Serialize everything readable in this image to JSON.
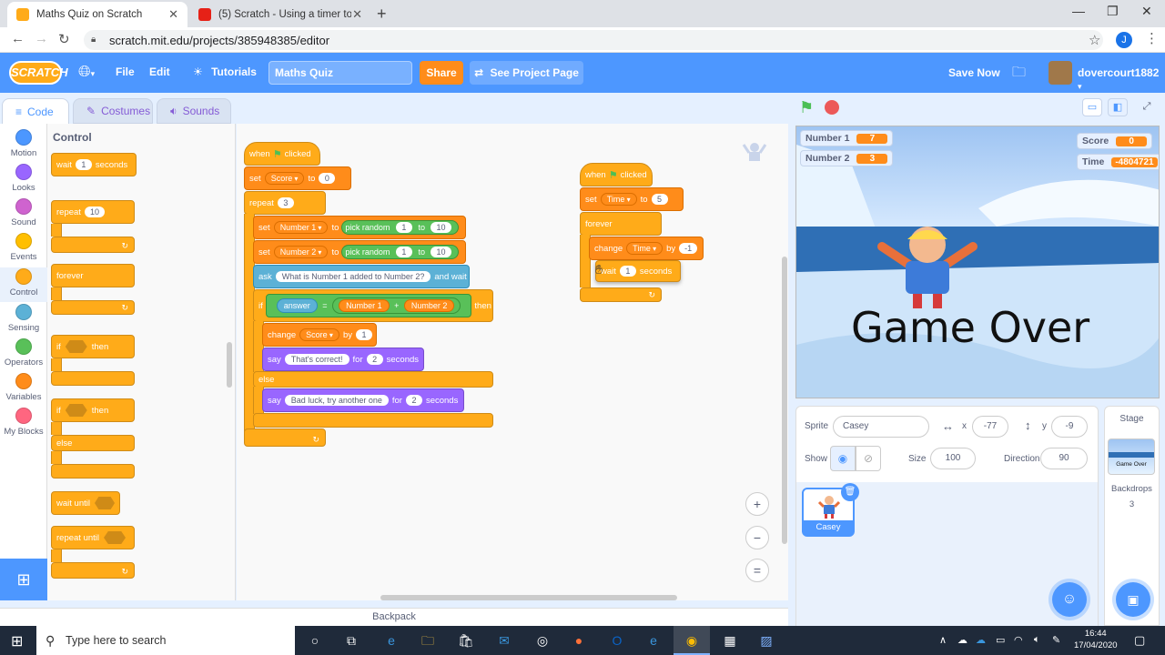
{
  "browser": {
    "tabs": [
      {
        "title": "Maths Quiz on Scratch",
        "close": "✕"
      },
      {
        "title": "(5) Scratch - Using a timer to end",
        "close": "✕"
      }
    ],
    "new_tab": "+",
    "url": "scratch.mit.edu/projects/385948385/editor",
    "profile_initial": "J"
  },
  "menu": {
    "logo": "SCRATCH",
    "file": "File",
    "edit": "Edit",
    "tutorials": "Tutorials",
    "project_title": "Maths Quiz",
    "share": "Share",
    "see_project": "See Project Page",
    "save_now": "Save Now",
    "username": "dovercourt1882"
  },
  "editor_tabs": {
    "code": "Code",
    "costumes": "Costumes",
    "sounds": "Sounds"
  },
  "categories": [
    {
      "label": "Motion",
      "color": "#4c97ff"
    },
    {
      "label": "Looks",
      "color": "#9966ff"
    },
    {
      "label": "Sound",
      "color": "#cf63cf"
    },
    {
      "label": "Events",
      "color": "#ffbf00"
    },
    {
      "label": "Control",
      "color": "#ffab19"
    },
    {
      "label": "Sensing",
      "color": "#5cb1d6"
    },
    {
      "label": "Operators",
      "color": "#59c059"
    },
    {
      "label": "Variables",
      "color": "#ff8c1a"
    },
    {
      "label": "My Blocks",
      "color": "#ff6680"
    }
  ],
  "palette": {
    "title": "Control",
    "wait": {
      "label": "wait",
      "value": "1",
      "unit": "seconds"
    },
    "repeat": {
      "label": "repeat",
      "value": "10"
    },
    "forever": "forever",
    "if_then": {
      "if": "if",
      "then": "then"
    },
    "if_else": {
      "if": "if",
      "then": "then",
      "else": "else"
    },
    "wait_until": "wait until",
    "repeat_until": "repeat until"
  },
  "script1": {
    "hat": {
      "when": "when",
      "clicked": "clicked"
    },
    "set_score": {
      "set": "set",
      "var": "Score",
      "to": "to",
      "value": "0"
    },
    "repeat": {
      "label": "repeat",
      "value": "3"
    },
    "set_n1": {
      "set": "set",
      "var": "Number 1",
      "to": "to",
      "pick": "pick random",
      "from": "1",
      "to2": "to",
      "max": "10"
    },
    "set_n2": {
      "set": "set",
      "var": "Number 2",
      "to": "to",
      "pick": "pick random",
      "from": "1",
      "to2": "to",
      "max": "10"
    },
    "ask": {
      "label": "ask",
      "question": "What is Number 1 added to Number 2?",
      "wait": "and wait"
    },
    "if": {
      "if": "if",
      "answer": "answer",
      "eq": "=",
      "n1": "Number 1",
      "plus": "+",
      "n2": "Number 2",
      "then": "then"
    },
    "change_score": {
      "change": "change",
      "var": "Score",
      "by": "by",
      "value": "1"
    },
    "say_correct": {
      "say": "say",
      "text": "That's correct!",
      "for": "for",
      "value": "2",
      "unit": "seconds"
    },
    "else": "else",
    "say_bad": {
      "say": "say",
      "text": "Bad luck, try another one",
      "for": "for",
      "value": "2",
      "unit": "seconds"
    }
  },
  "script2": {
    "hat": {
      "when": "when",
      "clicked": "clicked"
    },
    "set_time": {
      "set": "set",
      "var": "Time",
      "to": "to",
      "value": "5"
    },
    "forever": "forever",
    "change_time": {
      "change": "change",
      "var": "Time",
      "by": "by",
      "value": "-1"
    },
    "wait": {
      "label": "wait",
      "value": "1",
      "unit": "seconds"
    }
  },
  "workspace": {
    "zoom_in": "+",
    "zoom_out": "−",
    "reset": "="
  },
  "backpack": "Backpack",
  "stage": {
    "monitors": [
      {
        "name": "Number 1",
        "value": "7"
      },
      {
        "name": "Number 2",
        "value": "3"
      },
      {
        "name": "Score",
        "value": "0"
      },
      {
        "name": "Time",
        "value": "-4804721"
      }
    ],
    "game_over": "Game Over"
  },
  "sprite_info": {
    "sprite_label": "Sprite",
    "sprite_name": "Casey",
    "x_label": "x",
    "x": "-77",
    "y_label": "y",
    "y": "-9",
    "show_label": "Show",
    "size_label": "Size",
    "size": "100",
    "direction_label": "Direction",
    "direction": "90"
  },
  "sprites": [
    {
      "name": "Casey"
    }
  ],
  "stage_panel": {
    "title": "Stage",
    "thumb_text": "Game Over",
    "backdrops_label": "Backdrops",
    "backdrops_count": "3"
  },
  "taskbar": {
    "search_placeholder": "Type here to search",
    "time": "16:44",
    "date": "17/04/2020"
  }
}
